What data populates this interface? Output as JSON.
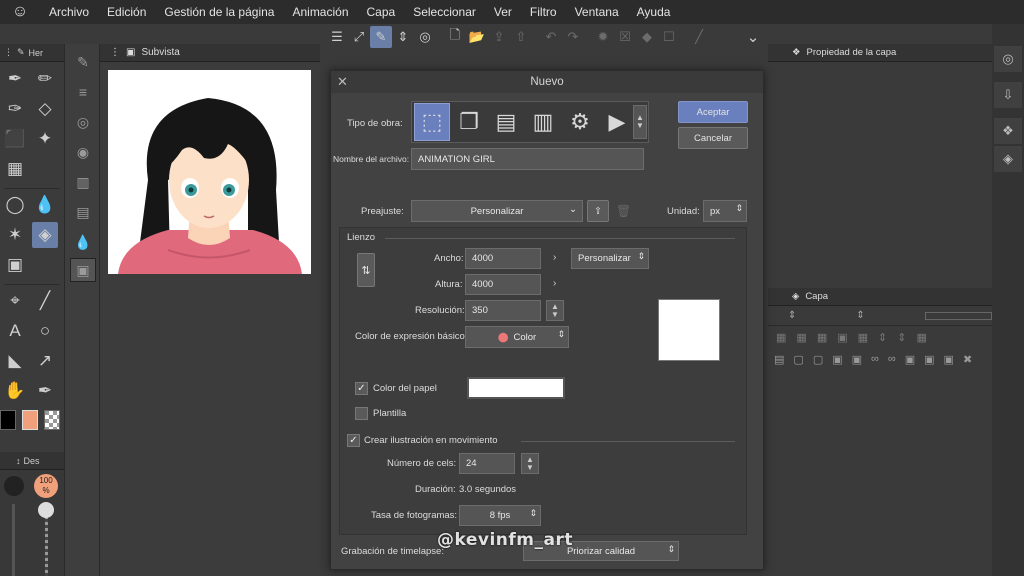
{
  "menu": {
    "items": [
      "Archivo",
      "Edición",
      "Gestión de la página",
      "Animación",
      "Capa",
      "Seleccionar",
      "Ver",
      "Filtro",
      "Ventana",
      "Ayuda"
    ]
  },
  "tool_panel": {
    "header_label": "Her"
  },
  "brush_panel": {
    "header_label": "Des",
    "opacity_value": "100",
    "opacity_unit": "%"
  },
  "subview": {
    "title": "Subvista"
  },
  "layer_property_panel": {
    "title": "Propiedad de la capa"
  },
  "layer_panel": {
    "title": "Capa"
  },
  "dialog": {
    "title": "Nuevo",
    "work_type_label": "Tipo de obra:",
    "filename_label": "Nombre del archivo:",
    "filename_value": "ANIMATION GIRL",
    "ok_label": "Aceptar",
    "cancel_label": "Cancelar",
    "preset_label": "Preajuste:",
    "preset_value": "Personalizar",
    "unit_label": "Unidad:",
    "unit_value": "px",
    "canvas_section": "Lienzo",
    "width_label": "Ancho:",
    "width_value": "4000",
    "height_label": "Altura:",
    "height_value": "4000",
    "size_preset_value": "Personalizar",
    "resolution_label": "Resolución:",
    "resolution_value": "350",
    "color_mode_label": "Color de expresión básico:",
    "color_mode_value": "Color",
    "paper_color_label": "Color del papel",
    "paper_color_checked": true,
    "paper_color": "#ffffff",
    "template_label": "Plantilla",
    "template_checked": false,
    "animation_label": "Crear ilustración en movimiento",
    "animation_checked": true,
    "cels_label": "Número de cels:",
    "cels_value": "24",
    "duration_label": "Duración:",
    "duration_value": "3.0 segundos",
    "framerate_label": "Tasa de fotogramas:",
    "framerate_value": "8 fps",
    "timelapse_label": "Grabación de timelapse:",
    "timelapse_value": "Priorizar calidad"
  },
  "watermark": "@kevinfm_art",
  "colors": {
    "main_color": "#000000",
    "sub_color": "#f0a07a",
    "accent": "#6a7fbe"
  }
}
